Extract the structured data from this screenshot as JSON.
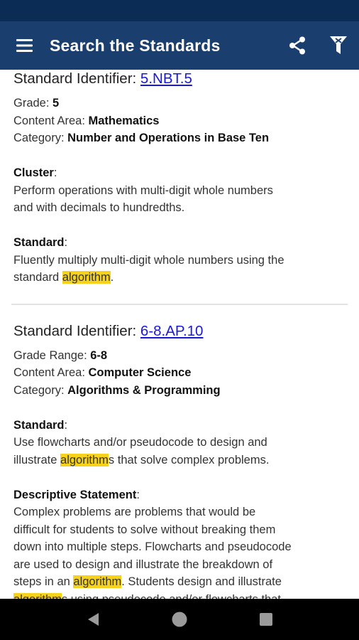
{
  "app_bar": {
    "title": "Search the Standards"
  },
  "record1": {
    "identifier_label": "Standard Identifier: ",
    "identifier": "5.NBT.5",
    "grade_label": "Grade: ",
    "grade": "5",
    "content_area_label": "Content Area: ",
    "content_area": "Mathematics",
    "category_label": "Category: ",
    "category": "Number and Operations in Base Ten",
    "cluster_heading": "Cluster",
    "cluster_text_1": "Perform operations with multi-digit whole numbers",
    "cluster_text_2": "and with decimals to hundredths.",
    "standard_heading": "Standard",
    "standard_text_1": "Fluently multiply multi-digit whole numbers using the",
    "standard_text_2_pre": "standard ",
    "standard_text_2_hl": "algorithm",
    "standard_text_2_post": "."
  },
  "record2": {
    "identifier_label": "Standard Identifier: ",
    "identifier": "6-8.AP.10",
    "grade_label": "Grade Range: ",
    "grade": "6-8",
    "content_area_label": "Content Area: ",
    "content_area": "Computer Science",
    "category_label": "Category: ",
    "category": "Algorithms & Programming",
    "standard_heading": "Standard",
    "standard_text_1": "Use flowcharts and/or pseudocode to design and",
    "standard_text_2_pre": "illustrate ",
    "standard_text_2_hl": "algorithm",
    "standard_text_2_post": "s that solve complex problems.",
    "desc_heading": "Descriptive Statement",
    "desc_1": "Complex problems are problems that would be",
    "desc_2": "difficult for students to solve without breaking them",
    "desc_3": "down into multiple steps. Flowcharts and pseudocode",
    "desc_4": "are used to design and illustrate the breakdown of",
    "desc_5_pre": "steps in an ",
    "desc_5_hl": "algorithm",
    "desc_5_post": ". Students design and illustrate",
    "desc_6_hl": "algorithm",
    "desc_6_post": "s using pseudocode and/or flowcharts that"
  },
  "colors": {
    "app_bar": "#1a3f6e",
    "status_bar": "#0b2c55",
    "highlight": "#f7d21a",
    "link": "#1a1ad6"
  },
  "icons": [
    "menu-icon",
    "share-icon",
    "filter-icon",
    "back-icon",
    "home-icon",
    "recents-icon"
  ]
}
